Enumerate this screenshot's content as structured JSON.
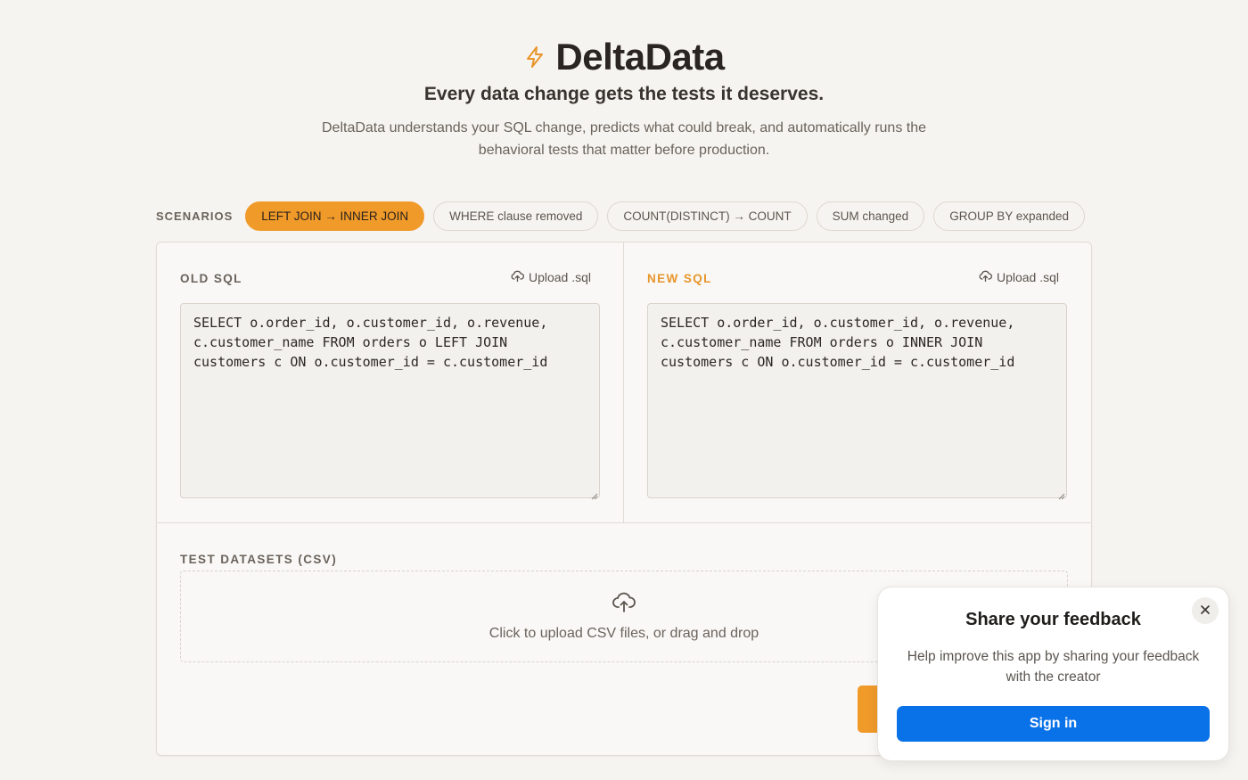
{
  "header": {
    "title": "DeltaData",
    "tagline": "Every data change gets the tests it deserves.",
    "description": "DeltaData understands your SQL change, predicts what could break, and automatically runs the behavioral tests that matter before production.",
    "icon": "lightning-icon"
  },
  "scenarios": {
    "label": "SCENARIOS",
    "items": [
      {
        "label": "LEFT JOIN → INNER JOIN",
        "active": true
      },
      {
        "label": "WHERE clause removed",
        "active": false
      },
      {
        "label": "COUNT(DISTINCT) → COUNT",
        "active": false
      },
      {
        "label": "SUM changed",
        "active": false
      },
      {
        "label": "GROUP BY expanded",
        "active": false
      }
    ]
  },
  "old_sql": {
    "label": "OLD SQL",
    "upload_label": "Upload .sql",
    "value": "SELECT o.order_id, o.customer_id, o.revenue, c.customer_name FROM orders o LEFT JOIN customers c ON o.customer_id = c.customer_id"
  },
  "new_sql": {
    "label": "NEW SQL",
    "upload_label": "Upload .sql",
    "value": "SELECT o.order_id, o.customer_id, o.revenue, c.customer_name FROM orders o INNER JOIN customers c ON o.customer_id = c.customer_id"
  },
  "datasets": {
    "label": "TEST DATASETS (CSV)",
    "dropzone_text": "Click to upload CSV files, or drag and drop"
  },
  "feedback": {
    "title": "Share your feedback",
    "body": "Help improve this app by sharing your feedback with the creator",
    "signin_label": "Sign in"
  },
  "colors": {
    "accent": "#f09a2a",
    "background": "#f6f4f0",
    "signin": "#0a72e8"
  }
}
